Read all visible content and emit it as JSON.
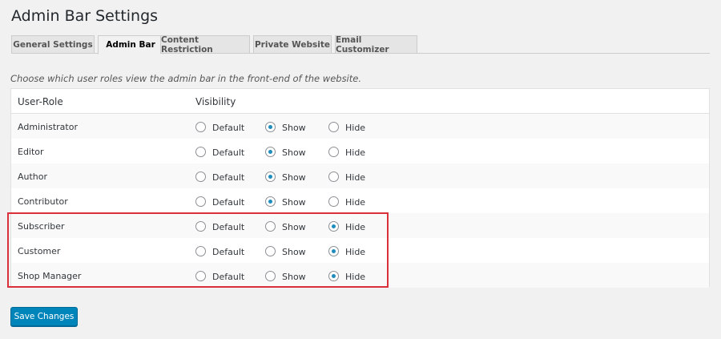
{
  "page": {
    "title": "Admin Bar Settings"
  },
  "tabs": [
    {
      "label": "General Settings",
      "active": false
    },
    {
      "label": "Admin Bar",
      "active": true
    },
    {
      "label": "Content Restriction",
      "active": false
    },
    {
      "label": "Private Website",
      "active": false
    },
    {
      "label": "Email Customizer",
      "active": false
    }
  ],
  "intro": "Choose which user roles view the admin bar in the front-end of the website.",
  "table": {
    "headers": {
      "role": "User-Role",
      "visibility": "Visibility"
    },
    "option_labels": {
      "default": "Default",
      "show": "Show",
      "hide": "Hide"
    },
    "rows": [
      {
        "role": "Administrator",
        "selected": "show"
      },
      {
        "role": "Editor",
        "selected": "show"
      },
      {
        "role": "Author",
        "selected": "show"
      },
      {
        "role": "Contributor",
        "selected": "show"
      },
      {
        "role": "Subscriber",
        "selected": "hide"
      },
      {
        "role": "Customer",
        "selected": "hide"
      },
      {
        "role": "Shop Manager",
        "selected": "hide"
      }
    ]
  },
  "save_button": "Save Changes",
  "colors": {
    "accent": "#0085ba",
    "radio_checked": "#1e8cbe",
    "highlight": "#d9303a"
  }
}
